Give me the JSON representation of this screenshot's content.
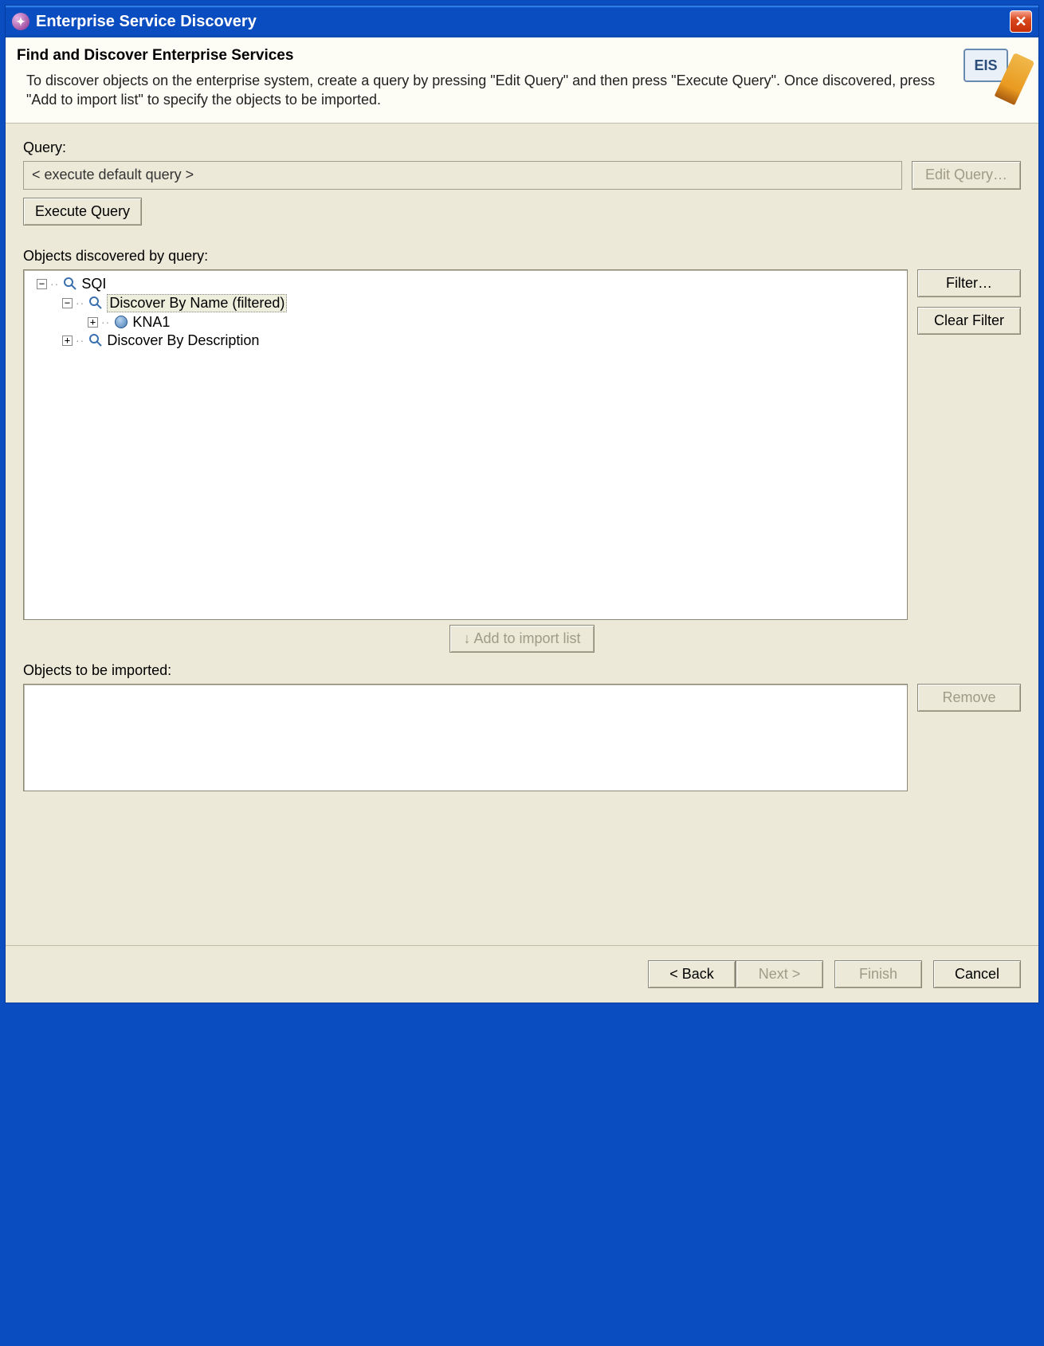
{
  "window": {
    "title": "Enterprise Service Discovery"
  },
  "header": {
    "title": "Find and Discover Enterprise Services",
    "description": "To discover objects on the enterprise system, create a query by pressing \"Edit Query\" and then press \"Execute Query\". Once discovered, press \"Add to import list\" to specify the objects to be imported.",
    "icon_label": "EIS"
  },
  "query": {
    "label": "Query:",
    "value": "< execute default query >",
    "edit_button": "Edit Query…",
    "execute_button": "Execute Query"
  },
  "discovered": {
    "label": "Objects discovered by query:",
    "filter_button": "Filter…",
    "clear_filter_button": "Clear Filter",
    "tree": {
      "root": "SQI",
      "by_name": "Discover By Name (filtered)",
      "kna1": "KNA1",
      "by_desc": "Discover By Description"
    },
    "add_button": "↓  Add to import list"
  },
  "import": {
    "label": "Objects to be imported:",
    "remove_button": "Remove"
  },
  "footer": {
    "back": "< Back",
    "next": "Next >",
    "finish": "Finish",
    "cancel": "Cancel"
  }
}
